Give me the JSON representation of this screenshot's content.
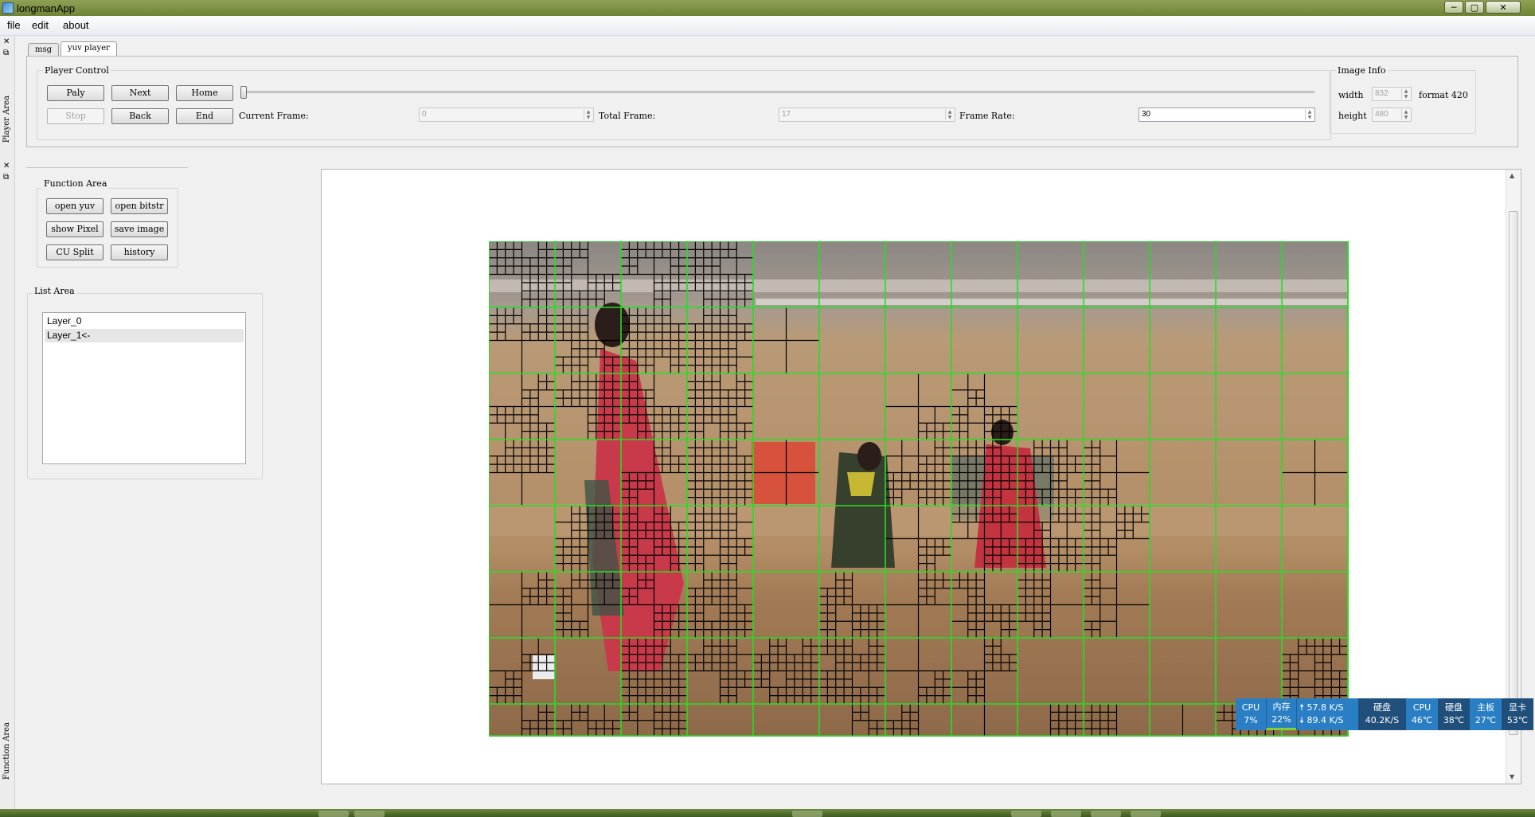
{
  "window": {
    "title": "longmanApp",
    "buttons": [
      "─",
      "▢",
      "✕"
    ]
  },
  "menu": [
    "file",
    "edit",
    "about"
  ],
  "docks": {
    "player_area": "Player Area",
    "function_area": "Function Area"
  },
  "tabs": [
    {
      "label": "msg",
      "active": false
    },
    {
      "label": "yuv player",
      "active": true
    }
  ],
  "player_control": {
    "title": "Player Control",
    "buttons": {
      "play": "Paly",
      "next": "Next",
      "home": "Home",
      "stop": "Stop",
      "back": "Back",
      "end": "End"
    },
    "current_frame_label": "Current Frame:",
    "current_frame": "0",
    "total_frame_label": "Total Frame:",
    "total_frame": "17",
    "frame_rate_label": "Frame Rate:",
    "frame_rate": "30",
    "slider_position": 0
  },
  "image_info": {
    "title": "Image Info",
    "width_label": "width",
    "width": "832",
    "format": "format 420",
    "height_label": "height",
    "height": "480"
  },
  "function_area": {
    "title": "Function Area",
    "buttons": {
      "open_yuv": "open yuv",
      "open_bitstr": "open bitstr",
      "show_pixel": "show Pixel",
      "save_image": "save image",
      "cu_split": "CU Split",
      "history": "history"
    }
  },
  "list_area": {
    "title": "List Area",
    "items": [
      "Layer_0",
      "Layer_1<-"
    ],
    "selected_index": 1
  },
  "netmon": {
    "cpu_label": "CPU",
    "cpu": "7%",
    "mem_label": "内存",
    "mem": "22%",
    "up": "57.8 K/S",
    "down": "89.4 K/S",
    "disk_label": "硬盘",
    "disk": "40.2K/S",
    "cpu_temp_label": "CPU",
    "cpu_temp": "46℃",
    "disk_temp_label": "硬盘",
    "disk_temp": "38℃",
    "board_label": "主板",
    "board_temp": "27℃",
    "gpu_label": "显卡",
    "gpu_temp": "53℃",
    "colors": {
      "blue": "#2a7fc4",
      "dark": "#1f4f7a",
      "accent": "#7fd13b"
    }
  },
  "colors": {
    "grid_green": "#22e022",
    "grid_black": "#000000",
    "titlebar": "#7a8f40"
  }
}
